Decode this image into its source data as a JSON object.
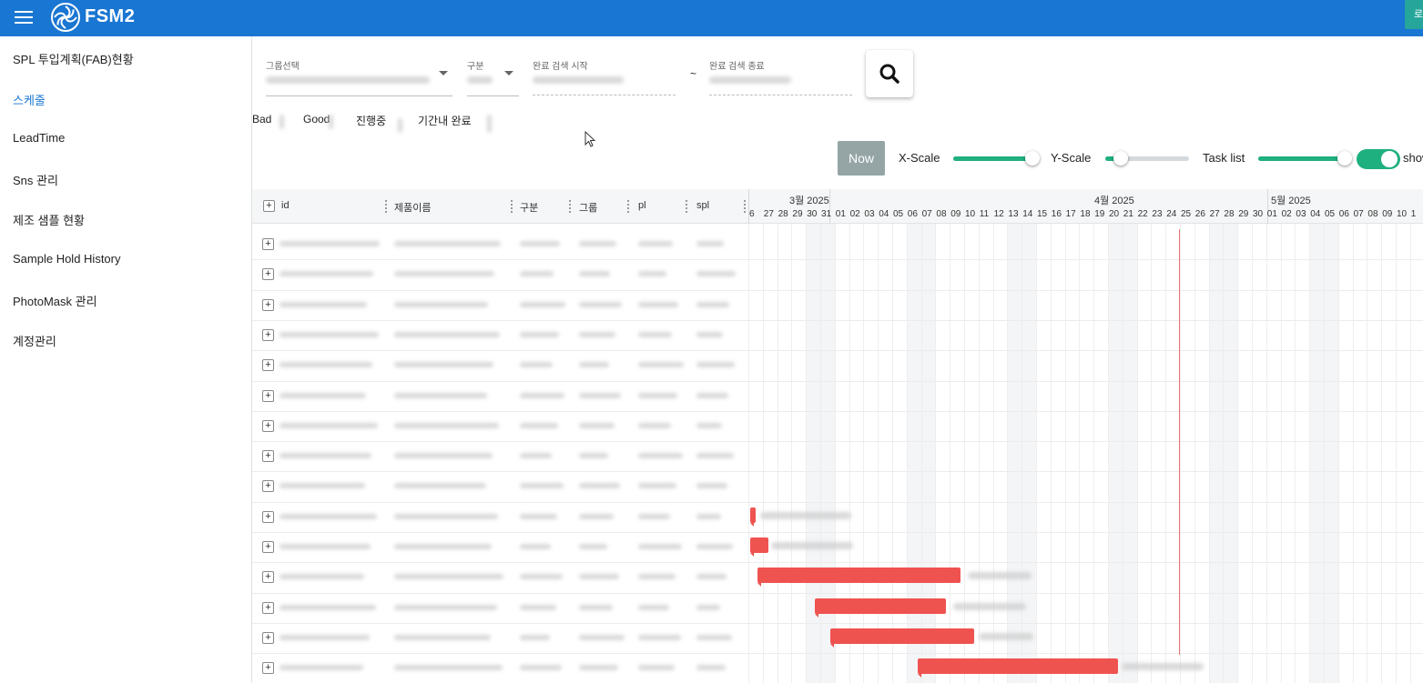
{
  "app": {
    "name": "FSM2",
    "top_right_label": "로"
  },
  "sidebar": {
    "items": [
      {
        "label": "SPL 투입계획(FAB)현황"
      },
      {
        "label": "스케줄"
      },
      {
        "label": "LeadTime"
      },
      {
        "label": "Sns 관리"
      },
      {
        "label": "제조 샘플 현황"
      },
      {
        "label": "Sample Hold History"
      },
      {
        "label": "PhotoMask 관리"
      },
      {
        "label": "계정관리"
      }
    ],
    "active_index": 1
  },
  "filters": {
    "group_label": "그룹선택",
    "type_label": "구분",
    "start_label": "완료 검색 시작",
    "tilde": "~",
    "end_label": "완료 검색 종료"
  },
  "legend": {
    "bad": "Bad",
    "good": "Good",
    "in_progress": "진행중",
    "done_in_time": "기간내 완료"
  },
  "controls": {
    "now_label": "Now",
    "xscale_label": "X-Scale",
    "xscale_value": 0.95,
    "yscale_label": "Y-Scale",
    "yscale_value": 0.18,
    "tasklist_label": "Task list",
    "tasklist_value": 0.98,
    "show_label": "show",
    "show_on": true
  },
  "gantt": {
    "columns": [
      "id",
      "제품이름",
      "구분",
      "그룹",
      "pl",
      "spl"
    ],
    "months": [
      "3월 2025",
      "4월 2025",
      "5월 2025"
    ],
    "days": [
      "6",
      "27",
      "28",
      "29",
      "30",
      "31",
      "01",
      "02",
      "03",
      "04",
      "05",
      "06",
      "07",
      "08",
      "09",
      "10",
      "11",
      "12",
      "13",
      "14",
      "15",
      "16",
      "17",
      "18",
      "19",
      "20",
      "21",
      "22",
      "23",
      "24",
      "25",
      "26",
      "27",
      "28",
      "29",
      "30",
      "01",
      "02",
      "03",
      "04",
      "05",
      "06",
      "07",
      "08",
      "09",
      "10",
      "1"
    ],
    "row_count": 15,
    "expand_symbol": "+"
  },
  "colors": {
    "topbar": "#1976d2",
    "accent": "#1fb07f",
    "bar": "#ef5350",
    "today": "#e57373",
    "now_button": "#95a5a6"
  }
}
